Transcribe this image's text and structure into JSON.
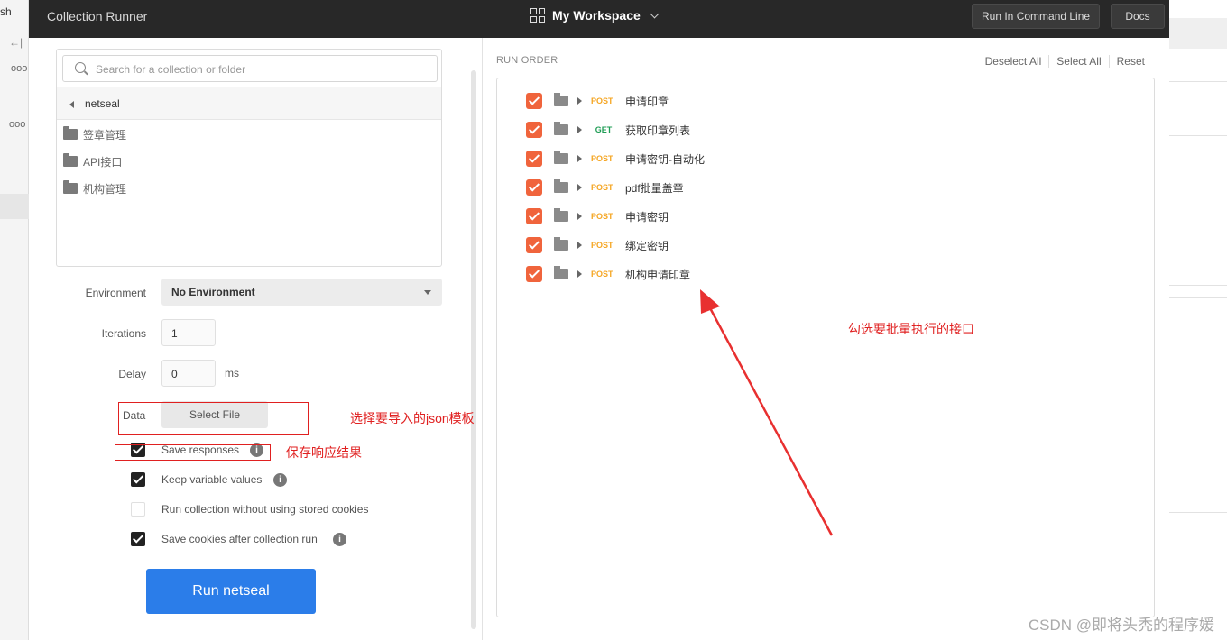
{
  "background": {
    "left_text": "sh",
    "left_ellipsis_1": "ooo",
    "left_ellipsis_2": "ooo"
  },
  "window": {
    "title": "Collection Runner",
    "workspace": "My Workspace",
    "run_cli_label": "Run In Command Line",
    "docs_label": "Docs"
  },
  "collection": {
    "search_placeholder": "Search for a collection or folder",
    "breadcrumb": "netseal",
    "folders": [
      "签章管理",
      "API接口",
      "机构管理"
    ]
  },
  "settings": {
    "environment_label": "Environment",
    "environment_value": "No Environment",
    "iterations_label": "Iterations",
    "iterations_value": "1",
    "delay_label": "Delay",
    "delay_value": "0",
    "delay_unit": "ms",
    "data_label": "Data",
    "select_file_label": "Select File",
    "options": [
      {
        "label": "Save responses",
        "checked": true,
        "info": true
      },
      {
        "label": "Keep variable values",
        "checked": true,
        "info": true
      },
      {
        "label": "Run collection without using stored cookies",
        "checked": false,
        "info": false
      },
      {
        "label": "Save cookies after collection run",
        "checked": true,
        "info": true
      }
    ],
    "run_button_label": "Run netseal"
  },
  "run_order": {
    "title": "RUN ORDER",
    "deselect_all": "Deselect All",
    "select_all": "Select All",
    "reset": "Reset",
    "method_colors": {
      "POST": "#f5a623",
      "GET": "#1f9d55"
    },
    "requests": [
      {
        "method": "POST",
        "name": "申请印章"
      },
      {
        "method": "GET",
        "name": "获取印章列表"
      },
      {
        "method": "POST",
        "name": "申请密钥-自动化"
      },
      {
        "method": "POST",
        "name": "pdf批量盖章"
      },
      {
        "method": "POST",
        "name": "申请密钥"
      },
      {
        "method": "POST",
        "name": "绑定密钥"
      },
      {
        "method": "POST",
        "name": "机构申请印章"
      }
    ]
  },
  "annotations": {
    "data_note": "选择要导入的json模板",
    "save_note": "保存响应结果",
    "select_note": "勾选要批量执行的接口",
    "color": "#e02020"
  },
  "watermark": "CSDN @即将头秃的程序媛"
}
